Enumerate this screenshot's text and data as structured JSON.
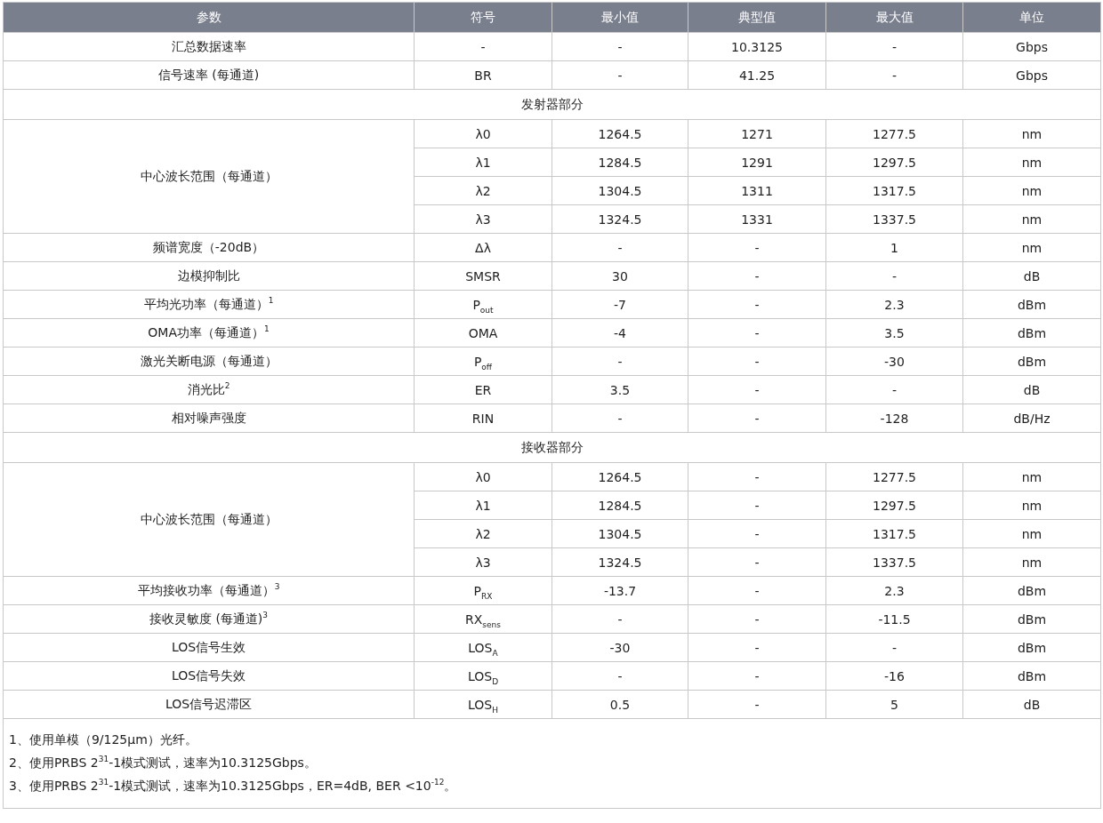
{
  "table": {
    "columns": [
      "参数",
      "符号",
      "最小值",
      "典型值",
      "最大值",
      "单位"
    ],
    "rows": [
      {
        "kind": "data",
        "cells": [
          "汇总数据速率",
          "-",
          "-",
          "10.3125",
          "-",
          "Gbps"
        ]
      },
      {
        "kind": "data",
        "cells": [
          "信号速率 (每通道)",
          "BR",
          "-",
          "41.25",
          "-",
          "Gbps"
        ]
      },
      {
        "kind": "section",
        "title": "发射器部分"
      },
      {
        "kind": "group",
        "parameter": "中心波长范围（每通道）",
        "rows": [
          [
            "λ0",
            "1264.5",
            "1271",
            "1277.5",
            "nm"
          ],
          [
            "λ1",
            "1284.5",
            "1291",
            "1297.5",
            "nm"
          ],
          [
            "λ2",
            "1304.5",
            "1311",
            "1317.5",
            "nm"
          ],
          [
            "λ3",
            "1324.5",
            "1331",
            "1337.5",
            "nm"
          ]
        ]
      },
      {
        "kind": "data",
        "cells": [
          "频谱宽度（-20dB）",
          "Δλ",
          "-",
          "-",
          "1",
          "nm"
        ]
      },
      {
        "kind": "data",
        "cells": [
          "边模抑制比",
          "SMSR",
          "30",
          "-",
          "-",
          "dB"
        ]
      },
      {
        "kind": "data",
        "cells": [
          "平均光功率（每通道）$^{1}$",
          "P$_{out}$",
          "-7",
          "-",
          "2.3",
          "dBm"
        ]
      },
      {
        "kind": "data",
        "cells": [
          "OMA功率（每通道）$^{1}$",
          "OMA",
          "-4",
          "-",
          "3.5",
          "dBm"
        ]
      },
      {
        "kind": "data",
        "cells": [
          "激光关断电源（每通道）",
          "P$_{off}$",
          "-",
          "-",
          "-30",
          "dBm"
        ]
      },
      {
        "kind": "data",
        "cells": [
          "消光比$^{2}$",
          "ER",
          "3.5",
          "-",
          "-",
          "dB"
        ]
      },
      {
        "kind": "data",
        "cells": [
          "相对噪声强度",
          "RIN",
          "-",
          "-",
          "-128",
          "dB/Hz"
        ]
      },
      {
        "kind": "section",
        "title": "接收器部分"
      },
      {
        "kind": "group",
        "parameter": "中心波长范围（每通道）",
        "rows": [
          [
            "λ0",
            "1264.5",
            "-",
            "1277.5",
            "nm"
          ],
          [
            "λ1",
            "1284.5",
            "-",
            "1297.5",
            "nm"
          ],
          [
            "λ2",
            "1304.5",
            "-",
            "1317.5",
            "nm"
          ],
          [
            "λ3",
            "1324.5",
            "-",
            "1337.5",
            "nm"
          ]
        ]
      },
      {
        "kind": "data",
        "cells": [
          "平均接收功率（每通道）$^{3}$",
          "P$_{RX}$",
          "-13.7",
          "-",
          "2.3",
          "dBm"
        ]
      },
      {
        "kind": "data",
        "cells": [
          "接收灵敏度 (每通道)$^{3}$",
          "RX$_{sens}$",
          "-",
          "-",
          "-11.5",
          "dBm"
        ]
      },
      {
        "kind": "data",
        "cells": [
          "LOS信号生效",
          "LOS$_{A}$",
          "-30",
          "-",
          "-",
          "dBm"
        ]
      },
      {
        "kind": "data",
        "cells": [
          "LOS信号失效",
          "LOS$_{D}$",
          "-",
          "-",
          "-16",
          "dBm"
        ]
      },
      {
        "kind": "data",
        "cells": [
          "LOS信号迟滞区",
          "LOS$_{H}$",
          "0.5",
          "-",
          "5",
          "dB"
        ]
      }
    ],
    "footnotes": [
      "1、使用单模（9/125μm）光纤。",
      "2、使用PRBS 2$^{31}$-1模式测试，速率为10.3125Gbps。",
      "3、使用PRBS 2$^{31}$-1模式测试，速率为10.3125Gbps，ER=4dB, BER <10$^{-12}$。"
    ]
  }
}
